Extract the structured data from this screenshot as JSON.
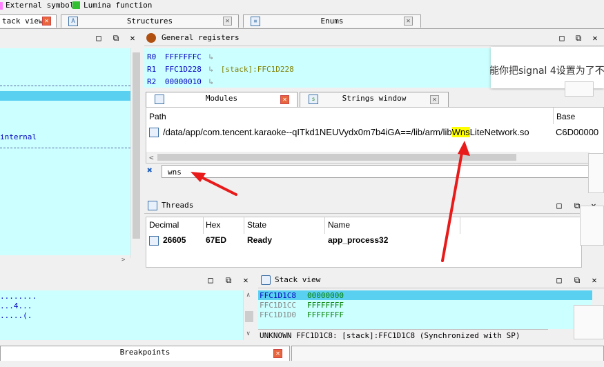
{
  "legend": {
    "external_symbol": "External symbol",
    "lumina_function": "Lumina function",
    "external_color": "#ff80ff",
    "lumina_color": "#30c030"
  },
  "top_tabs": {
    "stack_view": "tack view",
    "structures": "Structures",
    "enums": "Enums"
  },
  "left_panel": {
    "line_internal": "internal"
  },
  "general_registers": {
    "title": "General registers",
    "rows": [
      {
        "name": "R0",
        "value": "FFFFFFFC",
        "arrow": "↳",
        "ref": ""
      },
      {
        "name": "R1",
        "value": "FFC1D228",
        "arrow": "↳",
        "ref": "[stack]:FFC1D228"
      },
      {
        "name": "R2",
        "value": "00000010",
        "arrow": "↳",
        "ref": ""
      }
    ]
  },
  "chinese_banner": "能你把signal 4设置为了不",
  "module_tabs": {
    "modules": "Modules",
    "strings": "Strings window"
  },
  "modules": {
    "col_path": "Path",
    "col_base": "Base",
    "row_path_prefix": "/data/app/com.tencent.karaoke--qITkd1NEUVydx0m7b4iGA==/lib/arm/lib",
    "row_path_highlight": "Wns",
    "row_path_suffix": "LiteNetwork.so",
    "row_base": "C6D00000",
    "filter_value": "wns"
  },
  "threads": {
    "title": "Threads",
    "col_decimal": "Decimal",
    "col_hex": "Hex",
    "col_state": "State",
    "col_name": "Name",
    "row": {
      "decimal": "26605",
      "hex": "67ED",
      "state": "Ready",
      "name": "app_process32"
    }
  },
  "hex_panel": {
    "lines": [
      "........",
      "...4...",
      ".....(."
    ]
  },
  "stack_view": {
    "title": "Stack view",
    "rows": [
      {
        "addr": "FFC1D1C8",
        "value": "00000000"
      },
      {
        "addr": "FFC1D1CC",
        "value": "FFFFFFFF"
      },
      {
        "addr": "FFC1D1D0",
        "value": "FFFFFFFF"
      }
    ],
    "status": "UNKNOWN FFC1D1C8: [stack]:FFC1D1C8 (Synchronized with SP)"
  },
  "bottom_tabs": {
    "breakpoints": "Breakpoints"
  }
}
